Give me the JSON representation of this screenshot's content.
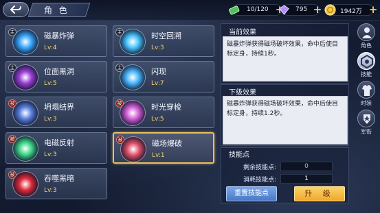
{
  "header": {
    "title": "角 色",
    "resources": [
      {
        "name": "stamina",
        "value": "10/120",
        "icon": "stamina-icon",
        "color": "#4fc35a"
      },
      {
        "name": "crystal",
        "value": "795",
        "icon": "crystal-icon",
        "color": "#b58cff"
      },
      {
        "name": "gold",
        "value": "1942万",
        "icon": "gold-coin-icon",
        "color": "#f2c84b"
      }
    ]
  },
  "skills": [
    {
      "name": "磁暴炸弹",
      "level": "Lv:4",
      "badge": "主",
      "badge_type": "main",
      "icon": "magnetic-bomb-icon",
      "color": "#3aa8ff"
    },
    {
      "name": "时空回溯",
      "level": "Lv:3",
      "badge": "主",
      "badge_type": "main",
      "icon": "time-rewind-icon",
      "color": "#49c4ff"
    },
    {
      "name": "位面黑洞",
      "level": "Lv:5",
      "badge": "主",
      "badge_type": "main",
      "icon": "black-hole-icon",
      "color": "#9a3fd6"
    },
    {
      "name": "闪现",
      "level": "Lv:7",
      "badge": "主",
      "badge_type": "main",
      "icon": "blink-icon",
      "color": "#4ab8ff"
    },
    {
      "name": "坍塌结界",
      "level": "Lv:3",
      "badge": "被",
      "badge_type": "passive",
      "icon": "collapse-barrier-icon",
      "color": "#5a7fe0"
    },
    {
      "name": "时光穿梭",
      "level": "Lv:5",
      "badge": "被",
      "badge_type": "passive",
      "icon": "time-travel-icon",
      "color": "#d35fd8"
    },
    {
      "name": "电磁反射",
      "level": "Lv:3",
      "badge": "被",
      "badge_type": "passive",
      "icon": "em-reflect-icon",
      "color": "#3fd88a"
    },
    {
      "name": "磁场爆破",
      "level": "Lv:1",
      "badge": "被",
      "badge_type": "passive",
      "icon": "magnetic-burst-icon",
      "color": "#e0506a",
      "selected": true
    },
    {
      "name": "吞噬黑暗",
      "level": "Lv:3",
      "badge": "被",
      "badge_type": "passive",
      "icon": "devour-darkness-icon",
      "color": "#e02a3a"
    }
  ],
  "current_effect": {
    "title": "当前效果",
    "text": "磁暴炸弹获得磁场破坏效果，命中后使目标定身，持续1秒。"
  },
  "next_effect": {
    "title": "下级效果",
    "text": "磁暴炸弹获得磁场破坏效果，命中后使目标定身，持续1.2秒。"
  },
  "skill_points": {
    "title": "技能点",
    "remaining_label": "剩余技能点:",
    "remaining_value": "0",
    "cost_label": "消耗技能点:",
    "cost_value": "1",
    "reset_label": "重置技能点",
    "upgrade_label": "升 级"
  },
  "side_tabs": [
    {
      "label": "角色",
      "icon": "character-icon"
    },
    {
      "label": "技能",
      "icon": "skill-icon",
      "active": true
    },
    {
      "label": "时装",
      "icon": "fashion-icon"
    },
    {
      "label": "军衔",
      "icon": "rank-icon"
    }
  ]
}
